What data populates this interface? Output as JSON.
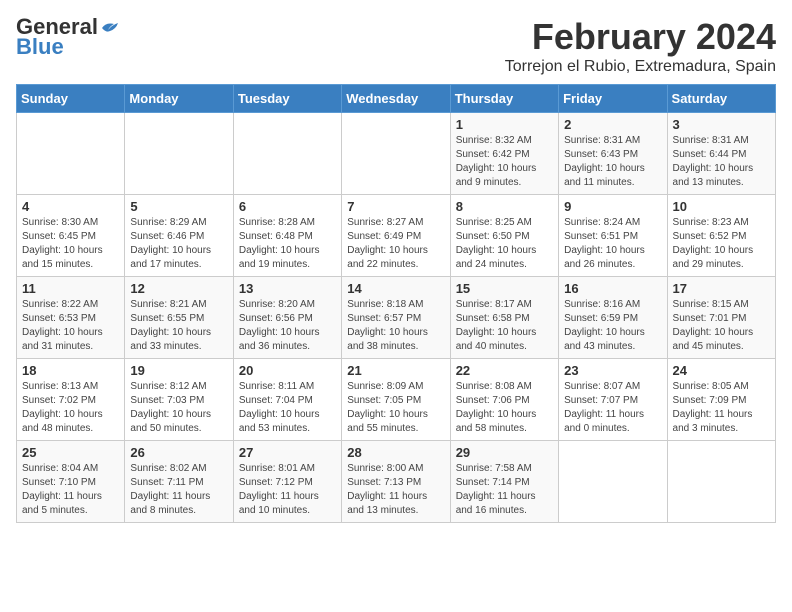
{
  "header": {
    "logo_line1": "General",
    "logo_line2": "Blue",
    "month_title": "February 2024",
    "location": "Torrejon el Rubio, Extremadura, Spain"
  },
  "weekdays": [
    "Sunday",
    "Monday",
    "Tuesday",
    "Wednesday",
    "Thursday",
    "Friday",
    "Saturday"
  ],
  "weeks": [
    [
      {
        "day": "",
        "info": ""
      },
      {
        "day": "",
        "info": ""
      },
      {
        "day": "",
        "info": ""
      },
      {
        "day": "",
        "info": ""
      },
      {
        "day": "1",
        "info": "Sunrise: 8:32 AM\nSunset: 6:42 PM\nDaylight: 10 hours\nand 9 minutes."
      },
      {
        "day": "2",
        "info": "Sunrise: 8:31 AM\nSunset: 6:43 PM\nDaylight: 10 hours\nand 11 minutes."
      },
      {
        "day": "3",
        "info": "Sunrise: 8:31 AM\nSunset: 6:44 PM\nDaylight: 10 hours\nand 13 minutes."
      }
    ],
    [
      {
        "day": "4",
        "info": "Sunrise: 8:30 AM\nSunset: 6:45 PM\nDaylight: 10 hours\nand 15 minutes."
      },
      {
        "day": "5",
        "info": "Sunrise: 8:29 AM\nSunset: 6:46 PM\nDaylight: 10 hours\nand 17 minutes."
      },
      {
        "day": "6",
        "info": "Sunrise: 8:28 AM\nSunset: 6:48 PM\nDaylight: 10 hours\nand 19 minutes."
      },
      {
        "day": "7",
        "info": "Sunrise: 8:27 AM\nSunset: 6:49 PM\nDaylight: 10 hours\nand 22 minutes."
      },
      {
        "day": "8",
        "info": "Sunrise: 8:25 AM\nSunset: 6:50 PM\nDaylight: 10 hours\nand 24 minutes."
      },
      {
        "day": "9",
        "info": "Sunrise: 8:24 AM\nSunset: 6:51 PM\nDaylight: 10 hours\nand 26 minutes."
      },
      {
        "day": "10",
        "info": "Sunrise: 8:23 AM\nSunset: 6:52 PM\nDaylight: 10 hours\nand 29 minutes."
      }
    ],
    [
      {
        "day": "11",
        "info": "Sunrise: 8:22 AM\nSunset: 6:53 PM\nDaylight: 10 hours\nand 31 minutes."
      },
      {
        "day": "12",
        "info": "Sunrise: 8:21 AM\nSunset: 6:55 PM\nDaylight: 10 hours\nand 33 minutes."
      },
      {
        "day": "13",
        "info": "Sunrise: 8:20 AM\nSunset: 6:56 PM\nDaylight: 10 hours\nand 36 minutes."
      },
      {
        "day": "14",
        "info": "Sunrise: 8:18 AM\nSunset: 6:57 PM\nDaylight: 10 hours\nand 38 minutes."
      },
      {
        "day": "15",
        "info": "Sunrise: 8:17 AM\nSunset: 6:58 PM\nDaylight: 10 hours\nand 40 minutes."
      },
      {
        "day": "16",
        "info": "Sunrise: 8:16 AM\nSunset: 6:59 PM\nDaylight: 10 hours\nand 43 minutes."
      },
      {
        "day": "17",
        "info": "Sunrise: 8:15 AM\nSunset: 7:01 PM\nDaylight: 10 hours\nand 45 minutes."
      }
    ],
    [
      {
        "day": "18",
        "info": "Sunrise: 8:13 AM\nSunset: 7:02 PM\nDaylight: 10 hours\nand 48 minutes."
      },
      {
        "day": "19",
        "info": "Sunrise: 8:12 AM\nSunset: 7:03 PM\nDaylight: 10 hours\nand 50 minutes."
      },
      {
        "day": "20",
        "info": "Sunrise: 8:11 AM\nSunset: 7:04 PM\nDaylight: 10 hours\nand 53 minutes."
      },
      {
        "day": "21",
        "info": "Sunrise: 8:09 AM\nSunset: 7:05 PM\nDaylight: 10 hours\nand 55 minutes."
      },
      {
        "day": "22",
        "info": "Sunrise: 8:08 AM\nSunset: 7:06 PM\nDaylight: 10 hours\nand 58 minutes."
      },
      {
        "day": "23",
        "info": "Sunrise: 8:07 AM\nSunset: 7:07 PM\nDaylight: 11 hours\nand 0 minutes."
      },
      {
        "day": "24",
        "info": "Sunrise: 8:05 AM\nSunset: 7:09 PM\nDaylight: 11 hours\nand 3 minutes."
      }
    ],
    [
      {
        "day": "25",
        "info": "Sunrise: 8:04 AM\nSunset: 7:10 PM\nDaylight: 11 hours\nand 5 minutes."
      },
      {
        "day": "26",
        "info": "Sunrise: 8:02 AM\nSunset: 7:11 PM\nDaylight: 11 hours\nand 8 minutes."
      },
      {
        "day": "27",
        "info": "Sunrise: 8:01 AM\nSunset: 7:12 PM\nDaylight: 11 hours\nand 10 minutes."
      },
      {
        "day": "28",
        "info": "Sunrise: 8:00 AM\nSunset: 7:13 PM\nDaylight: 11 hours\nand 13 minutes."
      },
      {
        "day": "29",
        "info": "Sunrise: 7:58 AM\nSunset: 7:14 PM\nDaylight: 11 hours\nand 16 minutes."
      },
      {
        "day": "",
        "info": ""
      },
      {
        "day": "",
        "info": ""
      }
    ]
  ]
}
